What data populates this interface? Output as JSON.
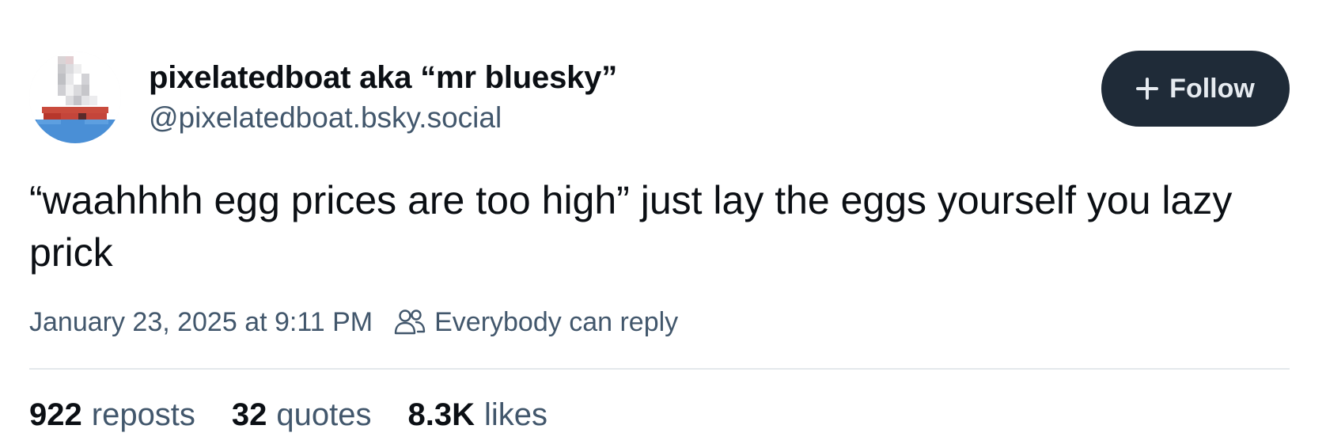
{
  "author": {
    "display_name": "pixelatedboat aka “mr bluesky”",
    "handle": "@pixelatedboat.bsky.social"
  },
  "follow_button": {
    "label": "Follow",
    "icon": "plus-icon"
  },
  "post": {
    "text": "“waahhhh egg prices are too high” just lay the eggs yourself you lazy prick"
  },
  "meta": {
    "timestamp": "January 23, 2025 at 9:11 PM",
    "reply_setting": "Everybody can reply",
    "reply_icon": "people-icon"
  },
  "stats": {
    "reposts": {
      "count": "922",
      "label": "reposts"
    },
    "quotes": {
      "count": "32",
      "label": "quotes"
    },
    "likes": {
      "count": "8.3K",
      "label": "likes"
    }
  },
  "colors": {
    "button_bg": "#1f2b38",
    "button_text": "#e6ebf0",
    "muted_text": "#42576c",
    "primary_text": "#0b0f14",
    "divider": "#e4e8ec"
  }
}
